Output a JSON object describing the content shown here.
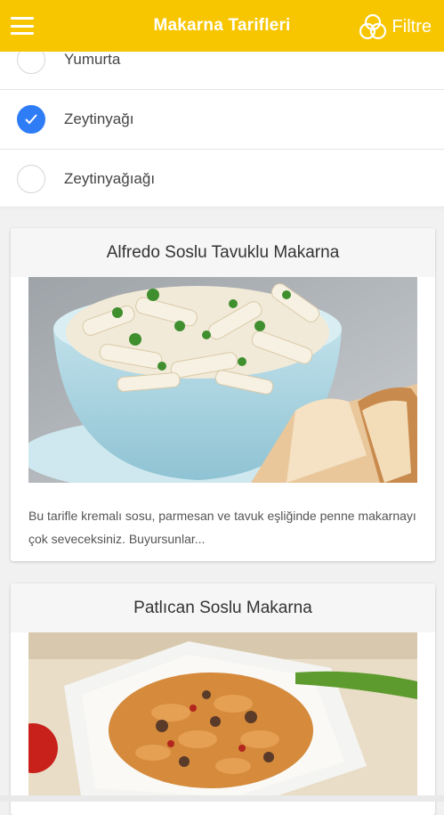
{
  "appbar": {
    "title": "Makarna Tarifleri",
    "filter_label": "Filtre",
    "menu_icon": "hamburger-menu-icon",
    "filter_icon": "filter-circles-icon",
    "color": "#f7c600"
  },
  "options": [
    {
      "label": "Yumurta",
      "checked": false
    },
    {
      "label": "Zeytinyağı",
      "checked": true
    },
    {
      "label": "Zeytinyağıağı",
      "checked": false
    }
  ],
  "recipes": [
    {
      "title": "Alfredo Soslu Tavuklu Makarna",
      "description": "Bu tarifle kremalı sosu, parmesan ve tavuk eşliğinde penne makarnayı çok seveceksiniz. Buyursunlar..."
    },
    {
      "title": "Patlıcan Soslu Makarna",
      "description": ""
    }
  ],
  "colors": {
    "accent": "#f7c600",
    "check": "#2e7cf6"
  }
}
